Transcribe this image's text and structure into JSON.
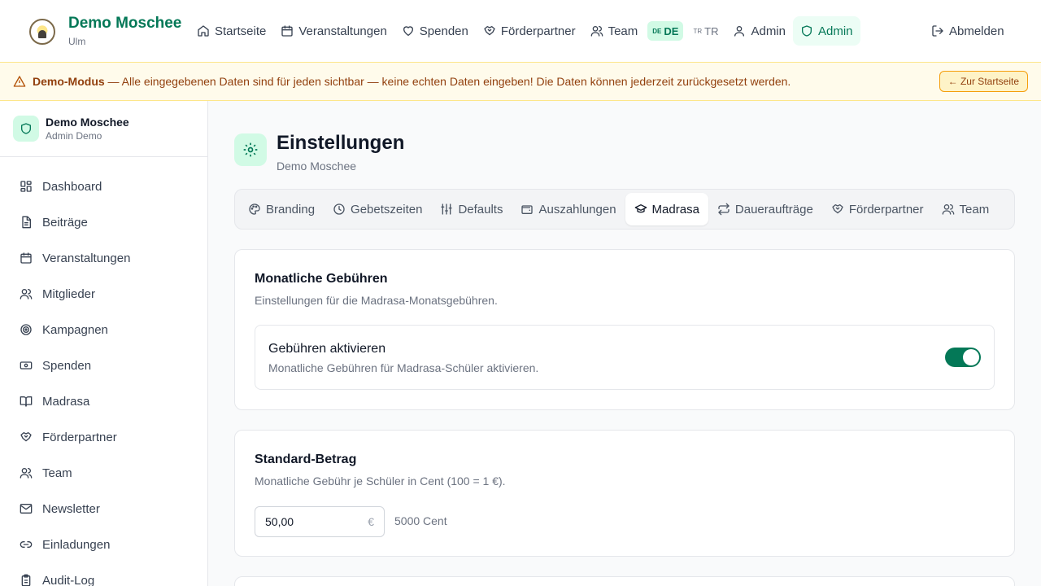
{
  "brand": {
    "title": "Demo Moschee",
    "subtitle": "Ulm"
  },
  "nav": {
    "items": [
      {
        "label": "Startseite",
        "icon": "home-icon"
      },
      {
        "label": "Veranstaltungen",
        "icon": "calendar-icon"
      },
      {
        "label": "Spenden",
        "icon": "heart-icon"
      },
      {
        "label": "Förderpartner",
        "icon": "handshake-icon"
      },
      {
        "label": "Team",
        "icon": "users-icon"
      }
    ],
    "lang_de": {
      "code": "DE",
      "flag": "DE"
    },
    "lang_tr": {
      "code": "TR",
      "flag": "TR"
    },
    "user": "Admin",
    "admin": "Admin",
    "logout": "Abmelden"
  },
  "banner": {
    "label": "Demo-Modus",
    "text": " — Alle eingegebenen Daten sind für jeden sichtbar — keine echten Daten eingeben! Die Daten können jederzeit zurückgesetzt werden.",
    "button": "← Zur Startseite"
  },
  "sidebar": {
    "title": "Demo Moschee",
    "subtitle": "Admin Demo",
    "items": [
      {
        "label": "Dashboard",
        "icon": "dashboard-icon"
      },
      {
        "label": "Beiträge",
        "icon": "document-icon"
      },
      {
        "label": "Veranstaltungen",
        "icon": "calendar-icon"
      },
      {
        "label": "Mitglieder",
        "icon": "users-icon"
      },
      {
        "label": "Kampagnen",
        "icon": "target-icon"
      },
      {
        "label": "Spenden",
        "icon": "banknote-icon"
      },
      {
        "label": "Madrasa",
        "icon": "book-icon"
      },
      {
        "label": "Förderpartner",
        "icon": "handshake-icon"
      },
      {
        "label": "Team",
        "icon": "users-icon"
      },
      {
        "label": "Newsletter",
        "icon": "mail-icon"
      },
      {
        "label": "Einladungen",
        "icon": "link-icon"
      },
      {
        "label": "Audit-Log",
        "icon": "clipboard-icon"
      }
    ]
  },
  "page": {
    "title": "Einstellungen",
    "subtitle": "Demo Moschee"
  },
  "tabs": [
    {
      "label": "Branding",
      "icon": "palette-icon"
    },
    {
      "label": "Gebetszeiten",
      "icon": "clock-icon"
    },
    {
      "label": "Defaults",
      "icon": "sliders-icon"
    },
    {
      "label": "Auszahlungen",
      "icon": "wallet-icon"
    },
    {
      "label": "Madrasa",
      "icon": "graduation-cap-icon",
      "active": true
    },
    {
      "label": "Daueraufträge",
      "icon": "repeat-icon"
    },
    {
      "label": "Förderpartner",
      "icon": "handshake-icon"
    },
    {
      "label": "Team",
      "icon": "users-icon"
    }
  ],
  "fees": {
    "title": "Monatliche Gebühren",
    "description": "Einstellungen für die Madrasa-Monatsgebühren.",
    "toggle_title": "Gebühren aktivieren",
    "toggle_description": "Monatliche Gebühren für Madrasa-Schüler aktivieren.",
    "enabled": true
  },
  "amount": {
    "title": "Standard-Betrag",
    "description": "Monatliche Gebühr je Schüler in Cent (100 = 1 €).",
    "value": "50,00",
    "currency": "€",
    "cents": "5000 Cent"
  },
  "colors": {
    "accent": "#047857",
    "accent_light": "#d1fae5",
    "banner_bg": "#fffbeb",
    "banner_text": "#92400e"
  }
}
